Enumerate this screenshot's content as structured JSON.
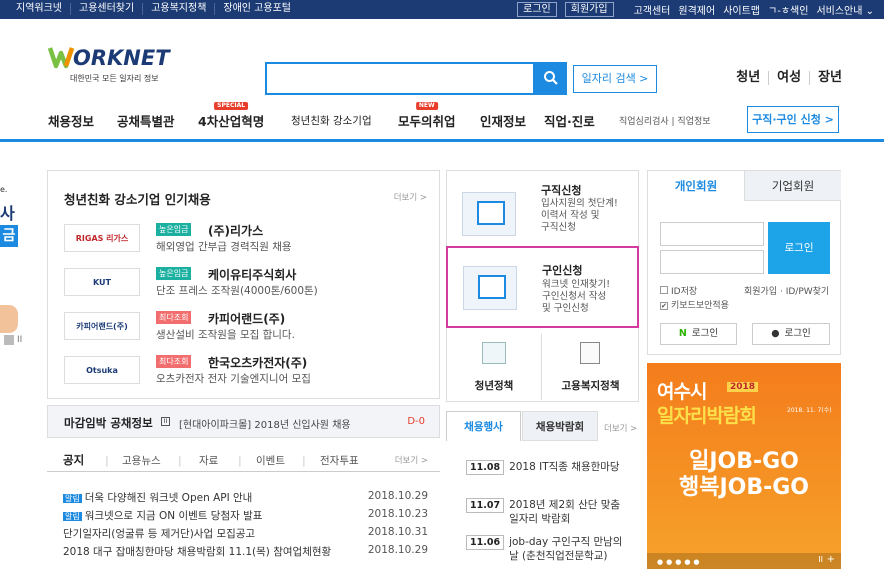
{
  "topbar": {
    "left": [
      "지역워크넷",
      "고용센터찾기",
      "고용복지정책",
      "장애인 고용포털"
    ],
    "login": "로그인",
    "join": "회원가입",
    "links": [
      "고객센터",
      "원격제어",
      "사이트맵",
      "ㄱ-ㅎ색인",
      "서비스안내 ⌄"
    ]
  },
  "logo": {
    "subtitle": "대한민국 모든 일자리 정보"
  },
  "search": {
    "button": "일자리 검색 >"
  },
  "yw": [
    "청년",
    "여성",
    "장년"
  ],
  "gnb": [
    "채용정보",
    "공채특별관",
    "4차산업혁명",
    "청년친화 강소기업",
    "모두의취업",
    "인재정보",
    "직업·진로",
    "직업심리검사 | 직업정보"
  ],
  "gnb_badges": {
    "special": "SPECIAL",
    "new": "NEW"
  },
  "apply": "구직·구인 신청 >",
  "popular": {
    "title": "청년친화 강소기업 인기채용",
    "more": "더보기 >",
    "companies": [
      {
        "logo": "RIGAS 리가스",
        "tag": "높은임금",
        "name": "(주)리가스",
        "desc": "해외영업 간부급 경력직원 채용",
        "color": "#1cb0a0"
      },
      {
        "logo": "KUT",
        "tag": "높은임금",
        "name": "케이유티주식회사",
        "desc": "단조 프레스 조작원(4000톤/600톤)",
        "color": "#1cb0a0"
      },
      {
        "logo": "카피어랜드(주)",
        "tag": "최다조회",
        "name": "카피어랜드(주)",
        "desc": "생산설비 조작원을 모집 합니다.",
        "color": "#f26d6d"
      },
      {
        "logo": "Otsuka",
        "tag": "최다조회",
        "name": "한국오츠카전자(주)",
        "desc": "오츠카전자 전자 기술엔지니어 모집",
        "color": "#f26d6d"
      }
    ]
  },
  "deadline": {
    "title": "마감임박 공채정보",
    "notice": "[현대아이파크몰] 2018년 신입사원 채용",
    "dday": "D-0"
  },
  "notice_tabs": [
    "공지",
    "고용뉴스",
    "자료",
    "이벤트",
    "전자투표"
  ],
  "notice_more": "더보기 >",
  "notices": [
    {
      "tag": "알림",
      "text": "더욱 다양해진 워크넷 Open API 안내",
      "date": "2018.10.29"
    },
    {
      "tag": "알림",
      "text": "워크넷으로 지금 ON 이벤트 당첨자 발표",
      "date": "2018.10.23"
    },
    {
      "tag": "",
      "text": "단기일자리(엉굴류 등 제거단)사업 모집공고",
      "date": "2018.10.31"
    },
    {
      "tag": "",
      "text": "2018 대구 잡매칭한마당 채용박람회 11.1(목) 참여업체현황",
      "date": "2018.10.29"
    }
  ],
  "services": [
    {
      "title": "구직신청",
      "desc": [
        "입사지원의 첫단계!",
        "이력서 작성 및",
        "구직신청"
      ]
    },
    {
      "title": "구인신청",
      "desc": [
        "워크넷 인재찾기!",
        "구인신청서 작성",
        "및 구인신청"
      ]
    }
  ],
  "policy": [
    "청년정책",
    "고용복지정책"
  ],
  "event_tabs": [
    "채용행사",
    "채용박람회"
  ],
  "event_more": "더보기 >",
  "events": [
    {
      "date": "11.08",
      "text": [
        "2018 IT직종 채용한마당"
      ]
    },
    {
      "date": "11.07",
      "text": [
        "2018년 제2회 산단 맞춤",
        "일자리 박람회"
      ]
    },
    {
      "date": "11.06",
      "text": [
        "job-day 구인구직 만남의",
        "날 (춘천직업전문학교)"
      ]
    }
  ],
  "member": {
    "tabs": [
      "개인회원",
      "기업회원"
    ],
    "login": "로그인",
    "save_id": "ID저장",
    "join_find": "회원가입 · ID/PW찾기",
    "keyboard": "키보드보안적용",
    "naver": "로그인",
    "kakao": "로그인"
  },
  "banner": {
    "title": "여수시",
    "year": "2018",
    "sub": "일자리박람회",
    "date": "2018. 11. 7(수)",
    "l1": "일JOB-GO",
    "l2": "행복JOB-GO"
  },
  "colors": {
    "navy": "#1c3b75",
    "blue": "#1c8ae0",
    "pink": "#d43b9f"
  }
}
